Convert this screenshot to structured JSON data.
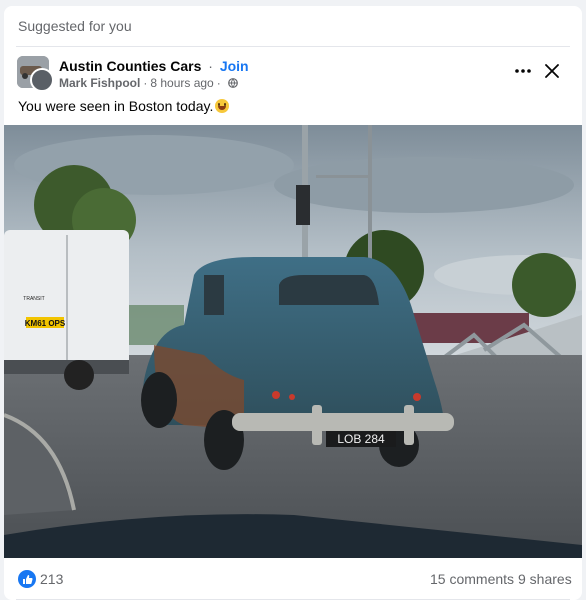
{
  "header": {
    "suggested_label": "Suggested for you"
  },
  "post": {
    "group_name": "Austin Counties Cars",
    "separator": "·",
    "join_label": "Join",
    "author": "Mark Fishpool",
    "time": "8 hours ago",
    "privacy_icon": "globe-icon",
    "text": "You were seen in Boston today.",
    "emoji": "grinning-face-emoji",
    "menu_icon": "more-horizontal-icon",
    "close_icon": "close-icon"
  },
  "photo": {
    "plate_car": "LOB 284",
    "plate_van": "KM61 OPS",
    "van_badge": "TRANSIT"
  },
  "footer": {
    "like_icon": "like-icon",
    "like_count": "213",
    "comments": "15 comments",
    "shares": "9 shares"
  },
  "colors": {
    "accent": "#1877f2",
    "secondary_text": "#65676b",
    "background": "#f0f2f5"
  }
}
